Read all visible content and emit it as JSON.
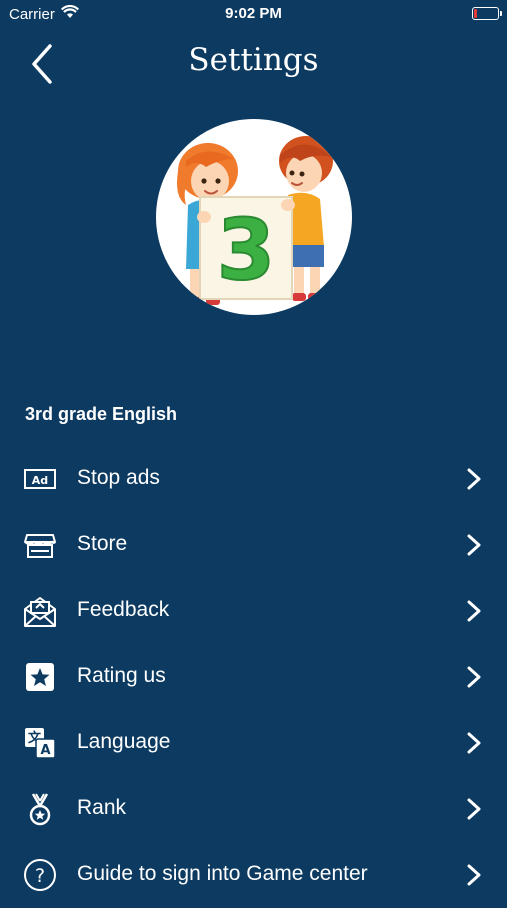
{
  "status_bar": {
    "carrier": "Carrier",
    "time": "9:02 PM",
    "battery_color": "#e53935"
  },
  "header": {
    "title": "Settings",
    "back_icon": "chevron-left-icon"
  },
  "avatar": {
    "image": "kids-holding-number-card",
    "card_number": "3"
  },
  "section": {
    "title": "3rd grade English"
  },
  "menu": {
    "items": [
      {
        "label": "Stop ads",
        "icon": "ad-icon"
      },
      {
        "label": "Store",
        "icon": "store-icon"
      },
      {
        "label": "Feedback",
        "icon": "mail-icon"
      },
      {
        "label": "Rating us",
        "icon": "star-icon"
      },
      {
        "label": "Language",
        "icon": "translate-icon"
      },
      {
        "label": "Rank",
        "icon": "medal-icon"
      },
      {
        "label": "Guide to sign into Game center",
        "icon": "question-icon"
      }
    ]
  },
  "colors": {
    "background": "#0c3a61",
    "text": "#ffffff",
    "card_number": "#3cb043"
  }
}
